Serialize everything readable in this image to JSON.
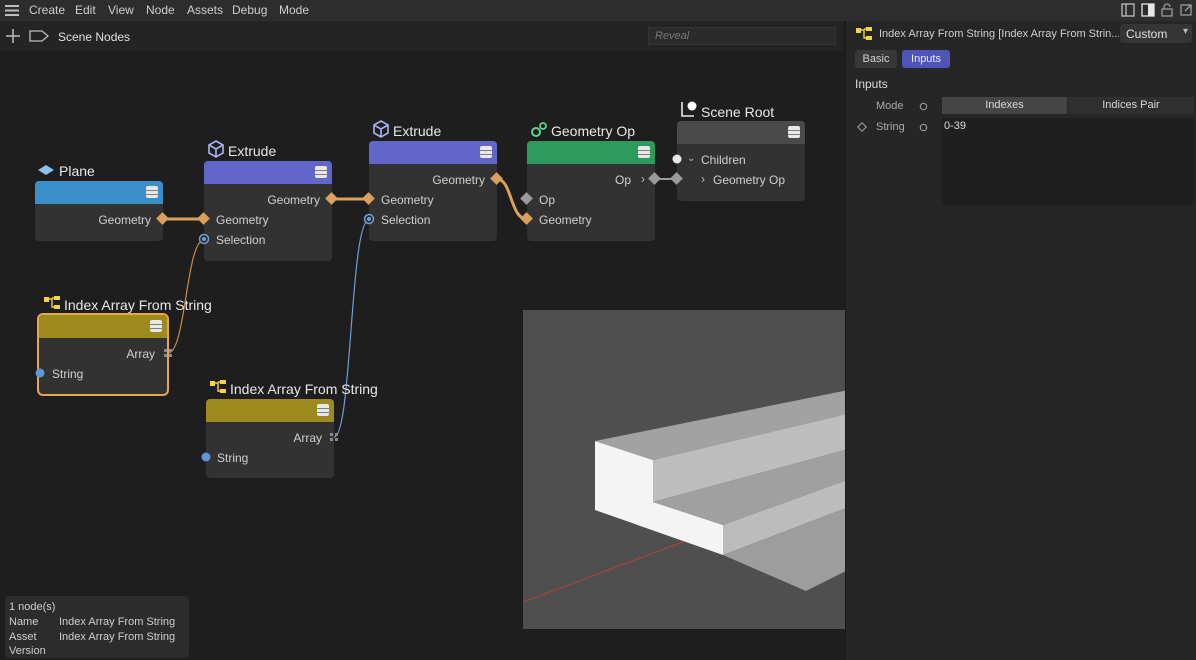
{
  "menu": {
    "items": [
      "Create",
      "Edit",
      "View",
      "Node",
      "Assets",
      "Debug",
      "Mode"
    ]
  },
  "editor": {
    "title": "Scene Nodes",
    "search_placeholder": "Reveal"
  },
  "nodes": {
    "plane": {
      "title": "Plane",
      "ports": {
        "geometry_out": "Geometry"
      },
      "color": "#3b8fc9"
    },
    "extrude1": {
      "title": "Extrude",
      "ports": {
        "geometry_out": "Geometry",
        "geometry_in": "Geometry",
        "selection_in": "Selection"
      },
      "color": "#6366c9"
    },
    "extrude2": {
      "title": "Extrude",
      "ports": {
        "geometry_out": "Geometry",
        "geometry_in": "Geometry",
        "selection_in": "Selection"
      },
      "color": "#6366c9"
    },
    "geometry_op": {
      "title": "Geometry Op",
      "ports": {
        "op_out": "Op",
        "op_in": "Op",
        "geometry_in": "Geometry"
      },
      "color": "#2e9a5c"
    },
    "scene_root": {
      "title": "Scene Root",
      "ports": {
        "children": "Children",
        "geometry_op": "Geometry Op"
      },
      "color": "#4a4a4a"
    },
    "index1": {
      "title": "Index Array From String",
      "ports": {
        "array_out": "Array",
        "string_in": "String"
      },
      "color": "#9c8a1d"
    },
    "index2": {
      "title": "Index Array From String",
      "ports": {
        "array_out": "Array",
        "string_in": "String"
      },
      "color": "#9c8a1d"
    }
  },
  "panel": {
    "title": "Index Array From String [Index Array From Strin...",
    "preset": "Custom",
    "tabs": [
      "Basic",
      "Inputs"
    ],
    "active_tab": "Inputs",
    "section": "Inputs",
    "mode_label": "Mode",
    "mode_options": [
      "Indexes",
      "Indices Pair"
    ],
    "mode_selected": "Indexes",
    "string_label": "String",
    "string_value": "0-39"
  },
  "status": {
    "count": "1 node(s)",
    "name_label": "Name",
    "name_value": "Index Array From String",
    "asset_label": "Asset",
    "asset_value": "Index Array From String",
    "version_label": "Version"
  }
}
